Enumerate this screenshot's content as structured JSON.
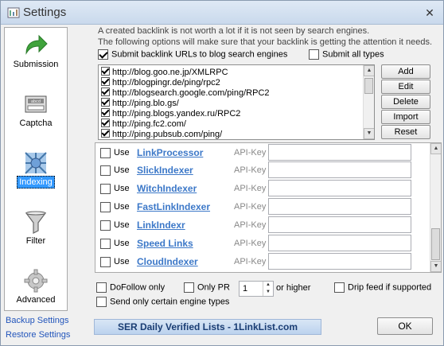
{
  "window": {
    "title": "Settings"
  },
  "sidebar": {
    "items": [
      {
        "label": "Submission",
        "icon": "green-arrow-icon"
      },
      {
        "label": "Captcha",
        "icon": "captcha-icon"
      },
      {
        "label": "Indexing",
        "icon": "indexing-icon",
        "active": true
      },
      {
        "label": "Filter",
        "icon": "funnel-icon"
      },
      {
        "label": "Advanced",
        "icon": "gear-icon"
      }
    ],
    "links": {
      "backup": "Backup Settings",
      "restore": "Restore Settings"
    }
  },
  "main": {
    "intro_line1": "A created backlink is not worth a lot if it is not seen by search engines.",
    "intro_line2": "The following options will make sure that your backlink is getting the attention it needs.",
    "submit_urls_label": "Submit backlink URLs to blog search engines",
    "submit_all_label": "Submit all types",
    "ping_urls": [
      "http://blog.goo.ne.jp/XMLRPC",
      "http://blogpingr.de/ping/rpc2",
      "http://blogsearch.google.com/ping/RPC2",
      "http://ping.blo.gs/",
      "http://ping.blogs.yandex.ru/RPC2",
      "http://ping.fc2.com/",
      "http://ping.pubsub.com/ping/"
    ],
    "buttons": {
      "add": "Add",
      "edit": "Edit",
      "delete": "Delete",
      "import": "Import",
      "reset": "Reset"
    },
    "indexers": {
      "use_label": "Use",
      "api_key_label": "API-Key",
      "items": [
        {
          "name": "LinkProcessor"
        },
        {
          "name": "SlickIndexer"
        },
        {
          "name": "WitchIndexer"
        },
        {
          "name": "FastLinkIndexer"
        },
        {
          "name": "LinkIndexr"
        },
        {
          "name": "Speed Links"
        },
        {
          "name": "CloudIndexer"
        }
      ]
    },
    "options": {
      "dofollow_only": "DoFollow only",
      "only_pr": "Only PR",
      "pr_value": "1",
      "or_higher": "or higher",
      "drip_feed": "Drip feed if supported",
      "send_certain": "Send only certain engine types"
    },
    "banner": "SER Daily Verified Lists - 1LinkList.com",
    "ok": "OK"
  }
}
